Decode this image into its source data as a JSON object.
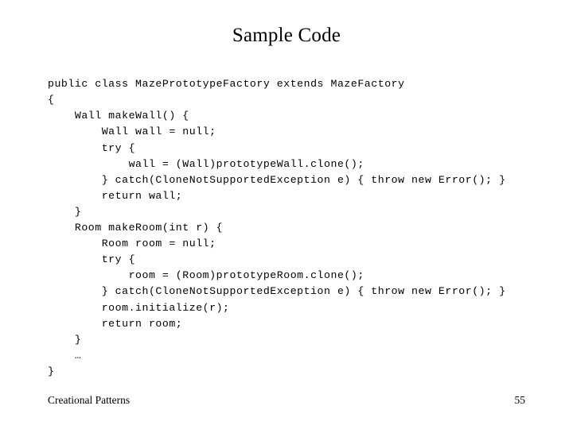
{
  "slide": {
    "title": "Sample Code",
    "background_color": "#ffffff",
    "text_color": "#000000"
  },
  "code": {
    "language": "java",
    "lines": [
      "public class MazePrototypeFactory extends MazeFactory",
      "{",
      "    Wall makeWall() {",
      "        Wall wall = null;",
      "        try {",
      "            wall = (Wall)prototypeWall.clone();",
      "        } catch(CloneNotSupportedException e) { throw new Error(); }",
      "        return wall;",
      "    }",
      "    Room makeRoom(int r) {",
      "        Room room = null;",
      "        try {",
      "            room = (Room)prototypeRoom.clone();",
      "        } catch(CloneNotSupportedException e) { throw new Error(); }",
      "        room.initialize(r);",
      "        return room;",
      "    }",
      "    …",
      "}"
    ]
  },
  "footer": {
    "left_text": "Creational Patterns",
    "page_number": "55"
  }
}
